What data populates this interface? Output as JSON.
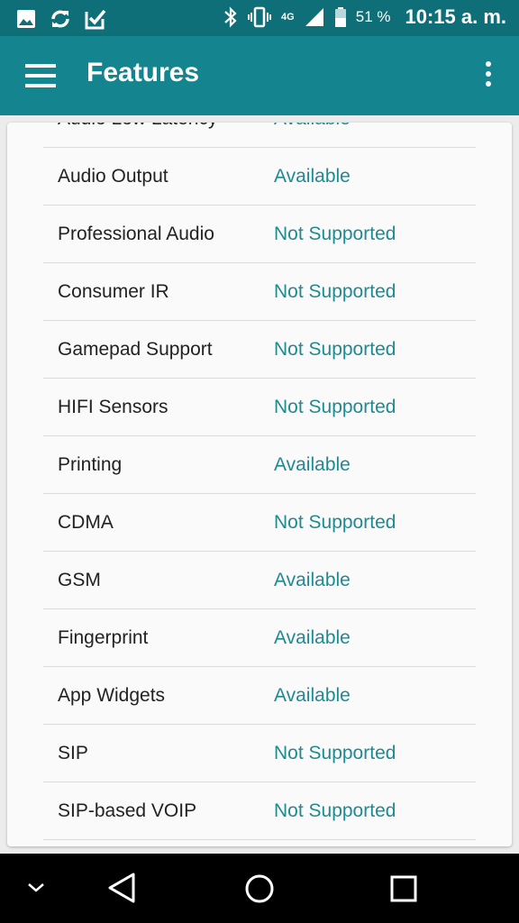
{
  "status_bar": {
    "network_label": "4G",
    "battery_percent": "51 %",
    "time": "10:15 a. m."
  },
  "app_bar": {
    "title": "Features"
  },
  "features": [
    {
      "name": "Audio Low Latency",
      "value": "Available"
    },
    {
      "name": "Audio Output",
      "value": "Available"
    },
    {
      "name": "Professional Audio",
      "value": "Not Supported"
    },
    {
      "name": "Consumer IR",
      "value": "Not Supported"
    },
    {
      "name": "Gamepad Support",
      "value": "Not Supported"
    },
    {
      "name": "HIFI Sensors",
      "value": "Not Supported"
    },
    {
      "name": "Printing",
      "value": "Available"
    },
    {
      "name": "CDMA",
      "value": "Not Supported"
    },
    {
      "name": "GSM",
      "value": "Available"
    },
    {
      "name": "Fingerprint",
      "value": "Available"
    },
    {
      "name": "App Widgets",
      "value": "Available"
    },
    {
      "name": "SIP",
      "value": "Not Supported"
    },
    {
      "name": "SIP-based VOIP",
      "value": "Not Supported"
    }
  ],
  "colors": {
    "status_bar": "#0f6f78",
    "app_bar": "#14858f",
    "value_text": "#1e8a91"
  },
  "icons": [
    "gallery-icon",
    "sync-icon",
    "checkbox-icon",
    "bluetooth-icon",
    "vibrate-icon",
    "signal-icon",
    "battery-icon",
    "hamburger-menu-icon",
    "overflow-menu-icon",
    "hide-keyboard-icon",
    "back-icon",
    "home-icon",
    "recents-icon"
  ]
}
